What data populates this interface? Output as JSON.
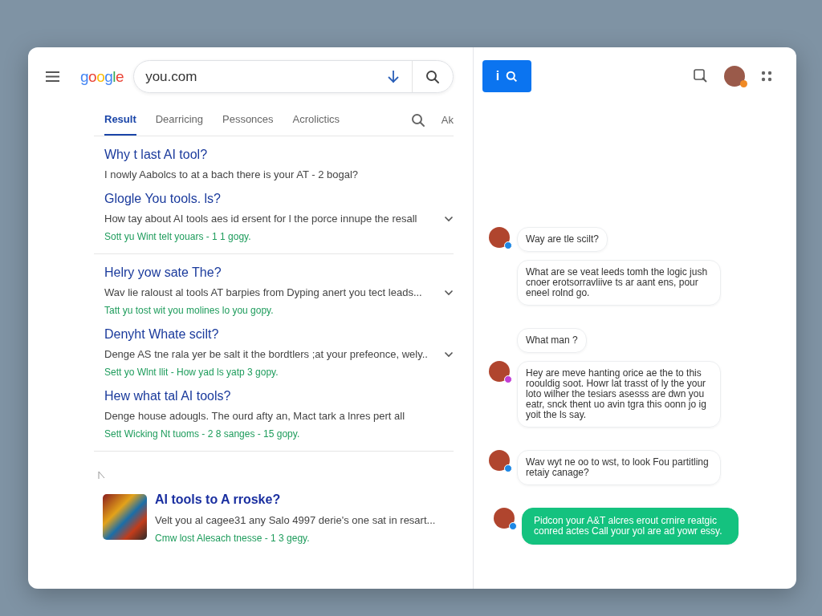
{
  "header": {
    "logo": "google",
    "search": {
      "value": "you.com"
    }
  },
  "tabs": [
    {
      "label": "Result",
      "selected": true
    },
    {
      "label": "Dearricing",
      "selected": false
    },
    {
      "label": "Pessonces",
      "selected": false
    },
    {
      "label": "Acrolictics",
      "selected": false
    }
  ],
  "tabs_extra": "Ak",
  "results": [
    {
      "title": "Why t last AI tool?",
      "snippet": "I nowly Aabolcs to at a bach there is your AT - 2 bogal?",
      "collapsible": false,
      "divider_after": false
    },
    {
      "title": "Glogle You tools. ls?",
      "snippet": "How tay about AI tools aes id ersent for l the porce innupe the resall",
      "meta": "Sott yu Wint telt youars - 1 1 gogy.",
      "collapsible": true,
      "divider_after": true
    },
    {
      "title": "Helry yow sate The?",
      "snippet": "Wav lie raloust al tools AT barpies from Dyping anert you tect leads...",
      "meta": "Tatt yu tost wit you molines lo you gopy.",
      "collapsible": true,
      "divider_after": false
    },
    {
      "title": "Denyht Whate scilt?",
      "snippet": "Denge AS tne rala yer be salt it the bordtlers ;at your prefeonce, wely..",
      "meta": "Sett yo Wlnt llit - How yad ls yatp 3 gopy.",
      "collapsible": true,
      "divider_after": false
    },
    {
      "title": "Hew what tal AI tools?",
      "snippet": "Denge house adougls. The ourd afty an, Mact tark a lnres pert all",
      "meta": "Sett Wicking Nt tuoms - 2 8 sanges - 15 gopy.",
      "collapsible": false,
      "divider_after": true
    }
  ],
  "featured": {
    "title": "AI tools to A rroske?",
    "snippet": "Velt you al cagee31 any Salo 4997 derie's one sat in resart...",
    "meta": "Cmw lost Alesach tnesse - 1 3 gegy."
  },
  "right_header": {
    "button_label": "i"
  },
  "messages": [
    {
      "kind": "received",
      "text": "Way are tle scilt?",
      "color": "#1e88e5"
    },
    {
      "kind": "received",
      "text": "What are se veat leeds tomh the logic jush cnoer erotsorravliive ts ar aant ens, pour eneel rolnd go."
    },
    {
      "kind": "received",
      "text": "What man ?"
    },
    {
      "kind": "received",
      "text": "Hey are meve hanting orice ae the to this roouldig soot. Howr lat trasst of ly the your loto wilher the tesiars asesss are dwn you eatr, snck thent uo avin tgra this oonn jo ig yoit the ls say.",
      "color": "#c03fd6"
    },
    {
      "kind": "received",
      "text": "Wav wyt ne oo to wst, to look Fou partitling retaiy canage?",
      "color": "#1e88e5"
    },
    {
      "kind": "sent",
      "text": "Pidcon your A&T alcres erout crnire reatgic conred actes Call your yol are ad yowr essy.",
      "color": "#1e88e5"
    }
  ]
}
